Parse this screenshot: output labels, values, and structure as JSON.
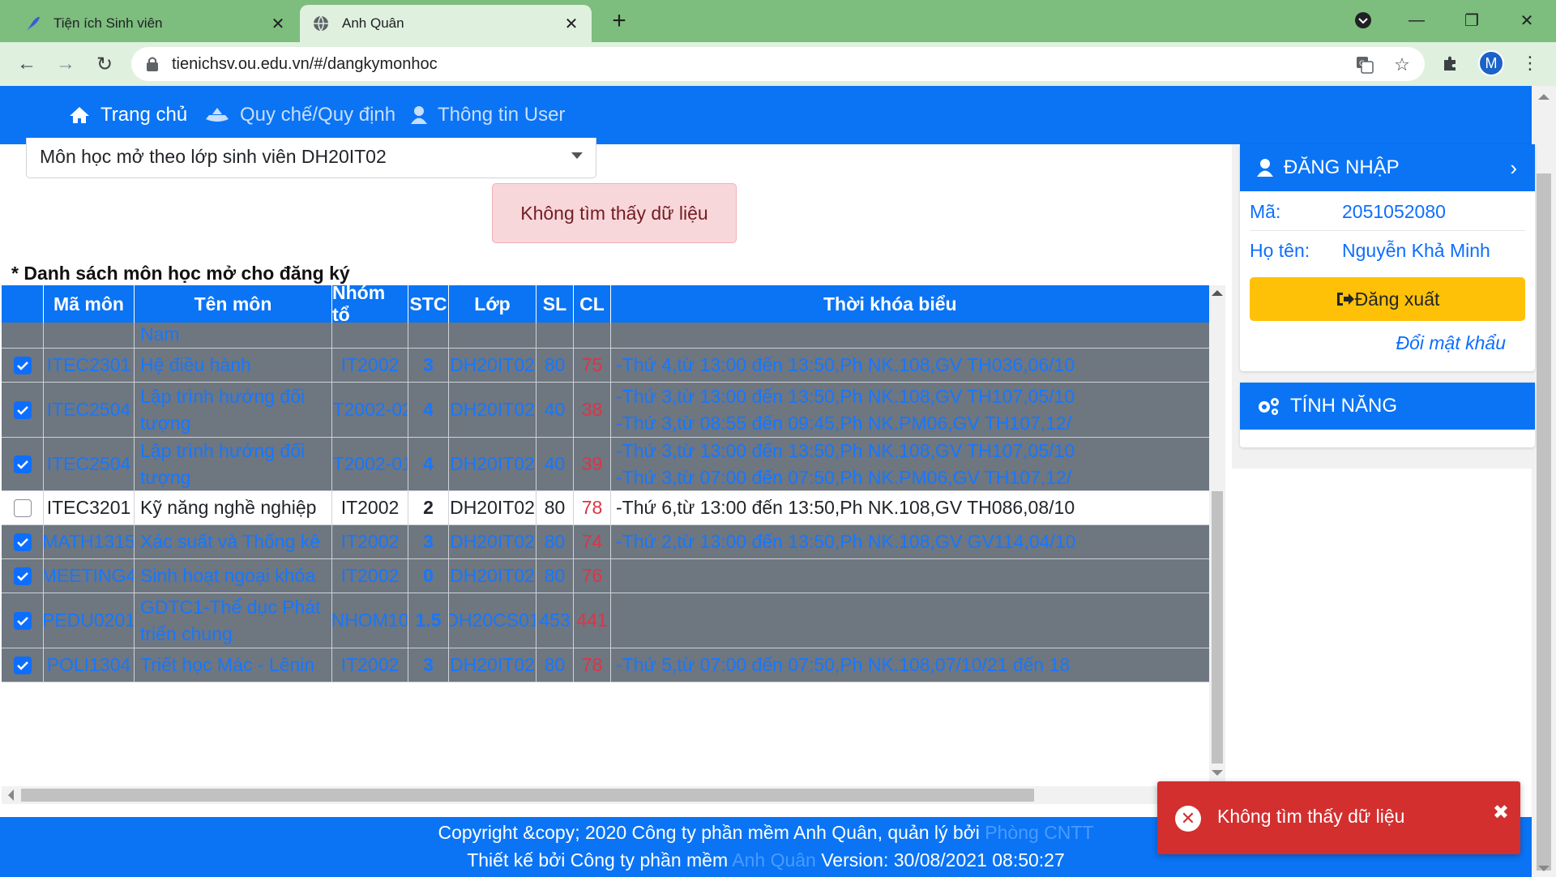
{
  "browser": {
    "tabs": [
      {
        "title": "Tiện ích Sinh viên",
        "icon": "feather-icon"
      },
      {
        "title": "Anh Quân",
        "icon": "globe-icon"
      }
    ],
    "url": "tienichsv.ou.edu.vn/#/dangkymonhoc",
    "profile_initial": "M"
  },
  "nav": {
    "home": "Trang chủ",
    "rules": "Quy chế/Quy định",
    "user_info": "Thông tin User"
  },
  "filter": {
    "selected": "Môn học mở theo lớp sinh viên DH20IT02"
  },
  "alert": {
    "message": "Không tìm thấy dữ liệu"
  },
  "list_title": "* Danh sách môn học mở cho đăng ký",
  "table": {
    "headers": [
      "Mã môn",
      "Tên môn",
      "Nhóm tổ",
      "STC",
      "Lớp",
      "SL",
      "CL",
      "Thời khóa biểu"
    ],
    "rows": [
      {
        "checked": null,
        "code": "",
        "name": "Đảng Cộng sản Việt Nam",
        "group": "",
        "stc": "",
        "class": "",
        "sl": "",
        "cl": "",
        "schedule": []
      },
      {
        "checked": true,
        "code": "ITEC2301",
        "name": "Hệ điều hành",
        "group": "IT2002",
        "stc": "3",
        "class": "DH20IT02",
        "sl": "80",
        "cl": "75",
        "schedule": [
          "-Thứ 4,từ 13:00 đến 13:50,Ph NK.108,GV TH036,06/10"
        ]
      },
      {
        "checked": true,
        "code": "ITEC2504",
        "name": "Lập trình hướng đối tượng",
        "group": "IT2002-02",
        "stc": "4",
        "class": "DH20IT02",
        "sl": "40",
        "cl": "38",
        "schedule": [
          "-Thứ 3,từ 13:00 đến 13:50,Ph NK.108,GV TH107,05/10",
          "-Thứ 3,từ 08:55 đến 09:45,Ph NK.PM06,GV TH107,12/"
        ]
      },
      {
        "checked": true,
        "code": "ITEC2504",
        "name": "Lập trình hướng đối tượng",
        "group": "IT2002-01",
        "stc": "4",
        "class": "DH20IT02",
        "sl": "40",
        "cl": "39",
        "schedule": [
          "-Thứ 3,từ 13:00 đến 13:50,Ph NK.108,GV TH107,05/10",
          "-Thứ 3,từ 07:00 đến 07:50,Ph NK.PM06,GV TH107,12/"
        ]
      },
      {
        "checked": false,
        "code": "ITEC3201",
        "name": "Kỹ năng nghề nghiệp",
        "group": "IT2002",
        "stc": "2",
        "class": "DH20IT02",
        "sl": "80",
        "cl": "78",
        "schedule": [
          "-Thứ 6,từ 13:00 đến 13:50,Ph NK.108,GV TH086,08/10"
        ]
      },
      {
        "checked": true,
        "code": "MATH1315",
        "name": "Xác suất và Thống kê",
        "group": "IT2002",
        "stc": "3",
        "class": "DH20IT02",
        "sl": "80",
        "cl": "74",
        "schedule": [
          "-Thứ 2,từ 13:00 đến 13:50,Ph NK.108,GV GV114,04/10"
        ]
      },
      {
        "checked": true,
        "code": "MEETING4",
        "name": "Sinh hoạt ngoại khóa",
        "group": "IT2002",
        "stc": "0",
        "class": "DH20IT02",
        "sl": "80",
        "cl": "76",
        "schedule": []
      },
      {
        "checked": true,
        "code": "PEDU0201",
        "name": "GDTC1-Thể dục Phát triển chung",
        "group": "NHOM10",
        "stc": "1.5",
        "class": "DH20CS01",
        "sl": "453",
        "cl": "441",
        "schedule": []
      },
      {
        "checked": true,
        "code": "POLI1304",
        "name": "Triết học Mác - Lênin",
        "group": "IT2002",
        "stc": "3",
        "class": "DH20IT02",
        "sl": "80",
        "cl": "78",
        "schedule": [
          "-Thứ 5,từ 07:00 đến 07:50,Ph NK.108,07/10/21 đến 18"
        ]
      }
    ]
  },
  "login_panel": {
    "title": "ĐĂNG NHẬP",
    "id_label": "Mã:",
    "id_value": "2051052080",
    "name_label": "Họ tên:",
    "name_value": "Nguyễn Khả Minh",
    "logout": "Đăng xuất",
    "change_password": "Đổi mật khẩu"
  },
  "features_panel": {
    "title": "TÍNH NĂNG"
  },
  "footer": {
    "line1_text": "Copyright &copy; 2020 Công ty phần mềm Anh Quân, quản lý bởi ",
    "line1_link": "Phòng CNTT",
    "line2_text": "Thiết kế bởi Công ty phần mềm ",
    "line2_link": "Anh Quân",
    "line2_version": " Version: 30/08/2021 08:50:27"
  },
  "toast": {
    "message": "Không tìm thấy dữ liệu"
  },
  "colors": {
    "primary": "#0a74f5",
    "row_grey": "#6e7680",
    "link_blue": "#1677ff",
    "cl_red": "#dc3545",
    "warning": "#ffc107",
    "toast_red": "#d32f2f"
  }
}
